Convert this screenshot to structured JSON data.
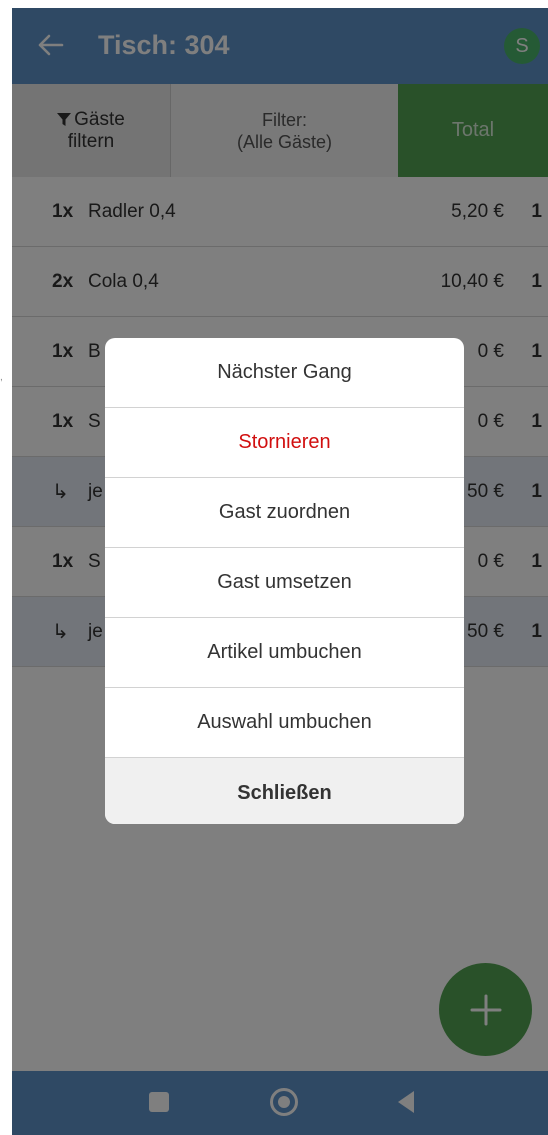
{
  "header": {
    "back_icon": "arrow-left-icon",
    "title": "Tisch: 304",
    "avatar_letter": "S"
  },
  "filterbar": {
    "guest_filter_label_line1": "Gäste",
    "guest_filter_label_line2": "filtern",
    "filter_icon": "funnel-icon",
    "filter_info_line1": "Filter:",
    "filter_info_line2": "(Alle Gäste)",
    "total_label": "Total"
  },
  "items": [
    {
      "type": "item",
      "qty": "1x",
      "name": "Radler 0,4",
      "price": "5,20 €",
      "count": "1"
    },
    {
      "type": "item",
      "qty": "2x",
      "name": "Cola 0,4",
      "price": "10,40 €",
      "count": "1"
    },
    {
      "type": "item",
      "qty": "1x",
      "name": "B",
      "price": "0 €",
      "count": "1"
    },
    {
      "type": "item",
      "qty": "1x",
      "name": "S",
      "price": "0 €",
      "count": "1"
    },
    {
      "type": "sub",
      "qty": "↳",
      "name": "je",
      "price": "50 €",
      "count": "1"
    },
    {
      "type": "item",
      "qty": "1x",
      "name": "S",
      "price": "0 €",
      "count": "1"
    },
    {
      "type": "sub",
      "qty": "↳",
      "name": "je",
      "price": "50 €",
      "count": "1"
    }
  ],
  "dialog": {
    "next_course": "Nächster Gang",
    "cancel": "Stornieren",
    "assign_guest": "Gast zuordnen",
    "move_guest": "Gast umsetzen",
    "rebook_item": "Artikel umbuchen",
    "rebook_selection": "Auswahl umbuchen",
    "close": "Schließen"
  },
  "fab": {
    "icon": "plus-icon",
    "label": "+"
  },
  "colors": {
    "header": "#5f93c8",
    "accent_green": "#52a352",
    "danger": "#d10f0f",
    "avatar": "#4ab56a"
  }
}
